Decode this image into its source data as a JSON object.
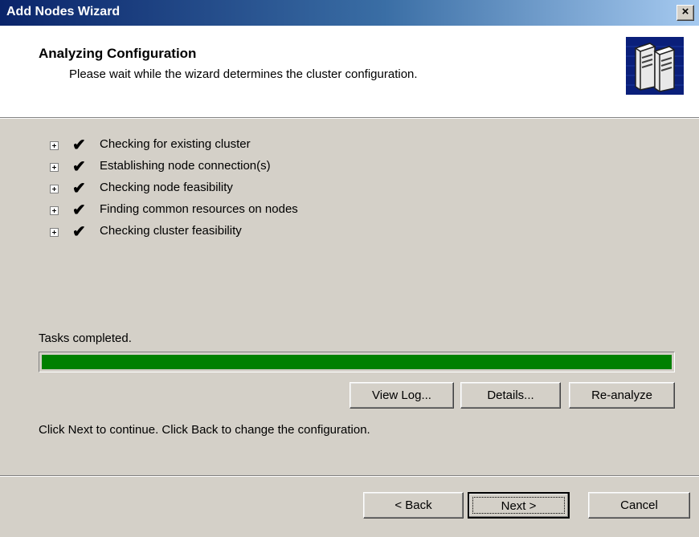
{
  "window": {
    "title": "Add Nodes Wizard",
    "close_label": "×"
  },
  "header": {
    "title": "Analyzing Configuration",
    "subtitle": "Please wait while the wizard determines the cluster configuration.",
    "icon": "server-cluster-icon"
  },
  "tasks": [
    {
      "label": "Checking for existing cluster",
      "status": "✔"
    },
    {
      "label": "Establishing node connection(s)",
      "status": "✔"
    },
    {
      "label": "Checking node feasibility",
      "status": "✔"
    },
    {
      "label": "Finding common resources on nodes",
      "status": "✔"
    },
    {
      "label": "Checking cluster feasibility",
      "status": "✔"
    }
  ],
  "status": {
    "text": "Tasks completed.",
    "progress_percent": 100,
    "progress_color": "#008000"
  },
  "actions": {
    "view_log": "View Log...",
    "details": "Details...",
    "reanalyze": "Re-analyze"
  },
  "instructions": "Click Next to continue. Click Back to change the configuration.",
  "footer": {
    "back": "< Back",
    "next": "Next >",
    "cancel": "Cancel"
  }
}
